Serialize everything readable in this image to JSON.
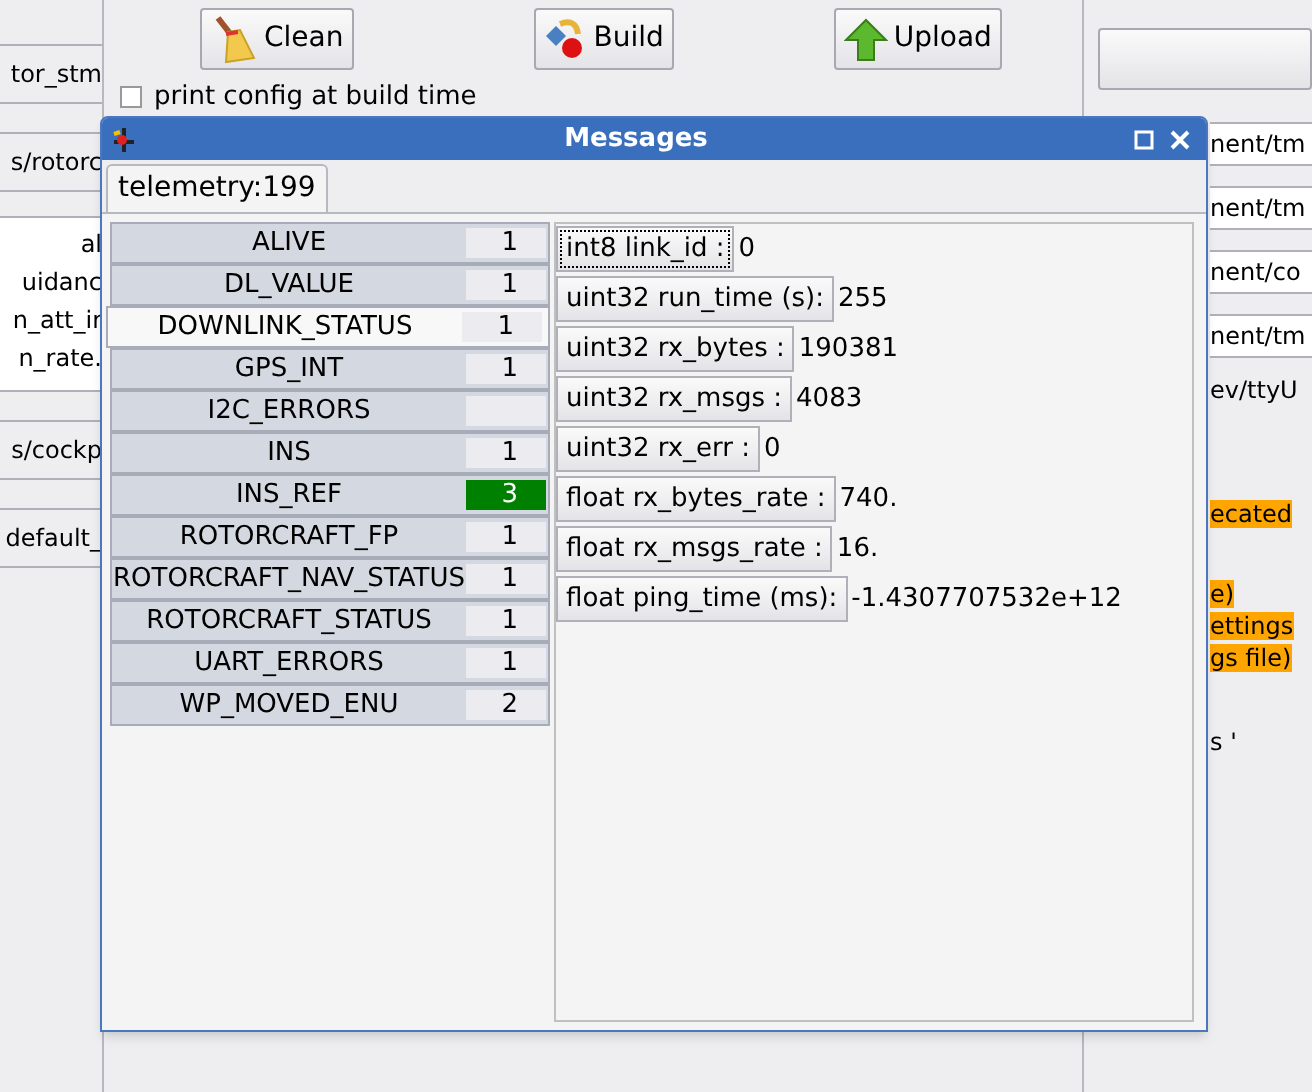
{
  "toolbar": {
    "buttons": [
      {
        "label": "Clean"
      },
      {
        "label": "Build"
      },
      {
        "label": "Upload"
      }
    ],
    "checkbox": {
      "label": "print config at build time",
      "checked": false
    }
  },
  "left_column": [
    {
      "kind": "entry",
      "text": "tor_stm"
    },
    {
      "kind": "entry",
      "text": "s/rotorc"
    },
    {
      "kind": "list",
      "items": [
        "al",
        "uidanc",
        "n_att_ir",
        "n_rate."
      ]
    },
    {
      "kind": "entry",
      "text": "s/cockp"
    },
    {
      "kind": "entry",
      "text": "default_"
    }
  ],
  "right_column": [
    {
      "kind": "entry",
      "text": "nent/tm",
      "highlighted": false
    },
    {
      "kind": "entry",
      "text": "nent/tm",
      "highlighted": false
    },
    {
      "kind": "entry",
      "text": "nent/co",
      "highlighted": false
    },
    {
      "kind": "entry",
      "text": "nent/tm",
      "highlighted": false
    },
    {
      "kind": "text",
      "text": "ev/ttyU",
      "highlighted": false
    },
    {
      "kind": "text",
      "text": "ecated",
      "highlighted": true
    },
    {
      "kind": "text",
      "text": "e)",
      "highlighted": true
    },
    {
      "kind": "text",
      "text": "ettings",
      "highlighted": true
    },
    {
      "kind": "text",
      "text": "gs file)",
      "highlighted": true
    },
    {
      "kind": "text",
      "text": "s '",
      "highlighted": false
    }
  ],
  "window": {
    "title": "Messages",
    "tabs": [
      {
        "label": "telemetry:199",
        "selected": true
      }
    ],
    "messages": [
      {
        "name": "ALIVE",
        "count": "1",
        "selected": false,
        "highlighted": false
      },
      {
        "name": "DL_VALUE",
        "count": "1",
        "selected": false,
        "highlighted": false
      },
      {
        "name": "DOWNLINK_STATUS",
        "count": "1",
        "selected": true,
        "highlighted": false
      },
      {
        "name": "GPS_INT",
        "count": "1",
        "selected": false,
        "highlighted": false
      },
      {
        "name": "I2C_ERRORS",
        "selected": false,
        "highlighted": false
      },
      {
        "name": "INS",
        "count": "1",
        "selected": false,
        "highlighted": false
      },
      {
        "name": "INS_REF",
        "count": "3",
        "selected": false,
        "highlighted": true
      },
      {
        "name": "ROTORCRAFT_FP",
        "count": "1",
        "selected": false,
        "highlighted": false
      },
      {
        "name": "ROTORCRAFT_NAV_STATUS",
        "count": "1",
        "selected": false,
        "highlighted": false
      },
      {
        "name": "ROTORCRAFT_STATUS",
        "count": "1",
        "selected": false,
        "highlighted": false
      },
      {
        "name": "UART_ERRORS",
        "count": "1",
        "selected": false,
        "highlighted": false
      },
      {
        "name": "WP_MOVED_ENU",
        "count": "2",
        "selected": false,
        "highlighted": false
      }
    ],
    "fields": [
      {
        "label": "int8 link_id :",
        "value": "0",
        "focused": true
      },
      {
        "label": "uint32 run_time (s):",
        "value": "255",
        "focused": false
      },
      {
        "label": "uint32 rx_bytes :",
        "value": "190381",
        "focused": false
      },
      {
        "label": "uint32 rx_msgs :",
        "value": "4083",
        "focused": false
      },
      {
        "label": "uint32 rx_err :",
        "value": "0",
        "focused": false
      },
      {
        "label": "float rx_bytes_rate :",
        "value": "740.",
        "focused": false
      },
      {
        "label": "float rx_msgs_rate :",
        "value": "16.",
        "focused": false
      },
      {
        "label": "float ping_time (ms):",
        "value": "-1.4307707532e+12",
        "focused": false
      }
    ]
  }
}
